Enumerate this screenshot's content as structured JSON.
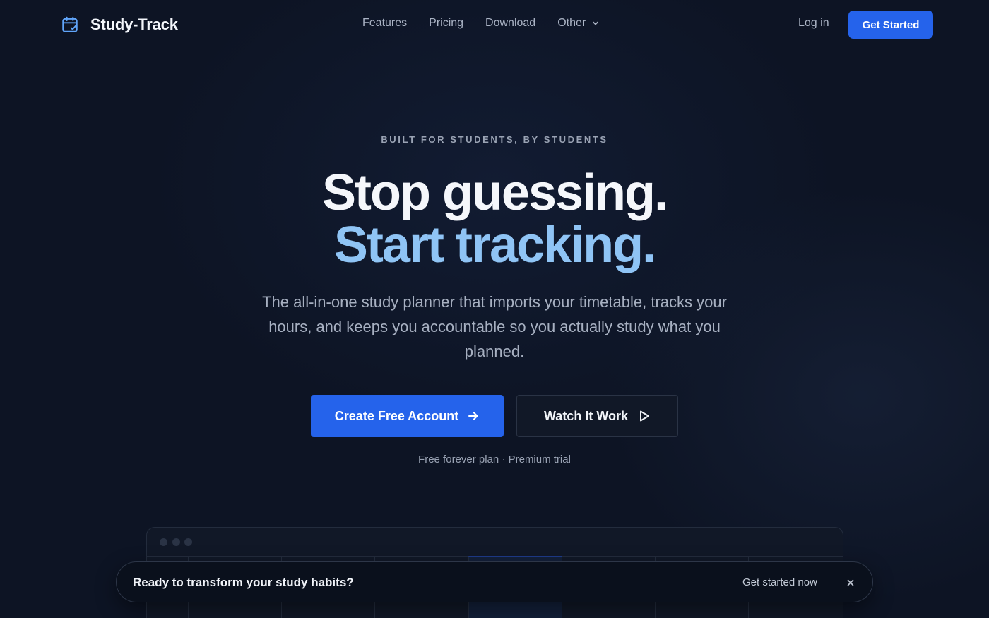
{
  "nav": {
    "brand": "Study-Track",
    "links": [
      {
        "label": "Features"
      },
      {
        "label": "Pricing"
      },
      {
        "label": "Download"
      },
      {
        "label": "Other"
      }
    ],
    "login": "Log in",
    "cta": "Get Started"
  },
  "hero": {
    "eyebrow": "BUILT FOR STUDENTS, BY STUDENTS",
    "headline_1": "Stop guessing.",
    "headline_2": "Start tracking.",
    "subtitle": "The all-in-one study planner that imports your timetable, tracks your hours, and keeps you accountable so you actually study what you planned.",
    "primary_cta": "Create Free Account",
    "secondary_cta": "Watch It Work",
    "fine_print": "Free forever plan · Premium trial"
  },
  "banner": {
    "text": "Ready to transform your study habits?",
    "link": "Get started now"
  },
  "colors": {
    "background": "#0d1424",
    "accent": "#2563eb",
    "headline_highlight": "#8fc4f5"
  },
  "icons": {
    "brand": "calendar-check-icon",
    "dropdown": "chevron-down-icon",
    "primary_cta": "arrow-right-icon",
    "secondary_cta": "play-icon",
    "banner_close": "close-icon"
  }
}
